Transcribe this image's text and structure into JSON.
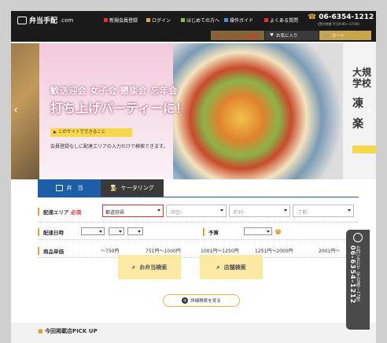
{
  "header": {
    "logo_text": "弁当手配",
    "logo_suffix": ".com",
    "nav": [
      {
        "label": "新規会員登録",
        "icon": "member-icon"
      },
      {
        "label": "ログイン",
        "icon": "key-icon"
      },
      {
        "label": "はじめての方へ",
        "icon": "beginner-icon"
      },
      {
        "label": "操作ガイド",
        "icon": "guide-icon"
      },
      {
        "label": "よくある質問",
        "icon": "faq-icon"
      }
    ],
    "phone": "06-6354-1212",
    "phone_hours": "(受付時間 平日9:00〜17:00)",
    "sub": {
      "request": "リクエスト商品",
      "favorite": "お気に入り",
      "cart": "カート"
    }
  },
  "hero": {
    "line1": "歓送迎会 女子会 懇談会 忘年会",
    "line2": "打ち上げパーティーに！",
    "tag": "このサイトでできること",
    "desc": "会員登録なしに配達エリアの入力だけで検索できます。",
    "right_l1": "大規",
    "right_l1b": "学校",
    "right_l2": "凍",
    "right_l3": "楽"
  },
  "tabs": {
    "bento": "弁　当",
    "catering": "ケータリング"
  },
  "form": {
    "area_label": "配達エリア",
    "required": "必須",
    "pref": "都道府県",
    "city": "-市区-",
    "town": "-町村-",
    "chome": "-丁目-",
    "date_label": "配達日時",
    "date_opts": [
      "",
      "",
      ""
    ],
    "budget_label": "予算",
    "budget_help": "?",
    "price_label": "商品単価",
    "prices": [
      "〜750円",
      "751円〜1000円",
      "1001円〜1250円",
      "1251円〜2000円",
      "2001円〜"
    ]
  },
  "buttons": {
    "bento_search": "お弁当検索",
    "shop_search": "店舗検索",
    "detail": "詳細検索を見る"
  },
  "bottom": {
    "pickup": "今回掲載店PICK UP"
  },
  "side_contact": {
    "label": "お問い合わせ（平日9時〜17時）",
    "phone": "06-6354-1212"
  },
  "colors": {
    "accent": "#1c5ea8",
    "gold": "#e0a33a",
    "button": "#fbe9a4",
    "dark": "#1a1a1a"
  }
}
